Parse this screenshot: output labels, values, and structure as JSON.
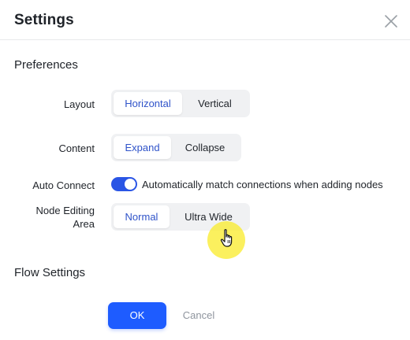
{
  "dialog": {
    "title": "Settings",
    "close_icon": "close-icon"
  },
  "preferences": {
    "title": "Preferences",
    "layout": {
      "label": "Layout",
      "options": [
        "Horizontal",
        "Vertical"
      ],
      "selected": "Horizontal"
    },
    "content": {
      "label": "Content",
      "options": [
        "Expand",
        "Collapse"
      ],
      "selected": "Expand"
    },
    "auto_connect": {
      "label": "Auto Connect",
      "enabled": true,
      "description": "Automatically match connections when adding nodes"
    },
    "node_editing_area": {
      "label_line1": "Node Editing",
      "label_line2": "Area",
      "options": [
        "Normal",
        "Ultra Wide"
      ],
      "selected": "Normal"
    }
  },
  "flow_settings": {
    "title": "Flow Settings"
  },
  "footer": {
    "ok_label": "OK",
    "cancel_label": "Cancel"
  },
  "colors": {
    "accent": "#1e5cff",
    "toggle_on": "#2a55e5",
    "selected_text": "#2f53c9",
    "segment_bg": "#f0f1f3",
    "cursor_highlight": "#faeb28"
  }
}
